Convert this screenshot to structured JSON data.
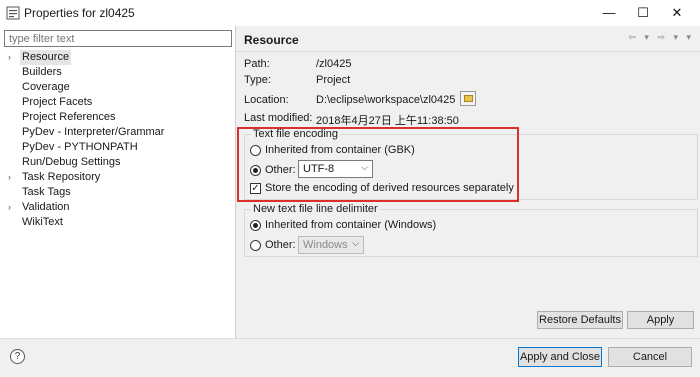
{
  "window": {
    "title": "Properties for zl0425",
    "minimize_glyph": "—",
    "maximize_glyph": "☐",
    "close_glyph": "✕"
  },
  "left": {
    "filter_placeholder": "type filter text",
    "tree": [
      {
        "label": "Resource",
        "expandable": true,
        "selected": true
      },
      {
        "label": "Builders",
        "expandable": false
      },
      {
        "label": "Coverage",
        "expandable": false
      },
      {
        "label": "Project Facets",
        "expandable": false
      },
      {
        "label": "Project References",
        "expandable": false
      },
      {
        "label": "PyDev - Interpreter/Grammar",
        "expandable": false
      },
      {
        "label": "PyDev - PYTHONPATH",
        "expandable": false
      },
      {
        "label": "Run/Debug Settings",
        "expandable": false
      },
      {
        "label": "Task Repository",
        "expandable": true
      },
      {
        "label": "Task Tags",
        "expandable": false
      },
      {
        "label": "Validation",
        "expandable": true
      },
      {
        "label": "WikiText",
        "expandable": false
      }
    ]
  },
  "right": {
    "title": "Resource",
    "nav_glyphs": "⇦ ▾ ⇨ ▾ ▾",
    "props": {
      "path_label": "Path:",
      "path_value": "/zl0425",
      "type_label": "Type:",
      "type_value": "Project",
      "location_label": "Location:",
      "location_value": "D:\\eclipse\\workspace\\zl0425",
      "modified_label": "Last modified:",
      "modified_value": "2018年4月27日 上午11:38:50"
    },
    "encoding": {
      "title": "Text file encoding",
      "inherited_label": "Inherited from container (GBK)",
      "other_label": "Other:",
      "other_value": "UTF-8",
      "store_label": "Store the encoding of derived resources separately",
      "selected": "other",
      "store_checked": true
    },
    "delimiter": {
      "title": "New text file line delimiter",
      "inherited_label": "Inherited from container (Windows)",
      "other_label": "Other:",
      "other_value": "Windows",
      "selected": "inherited"
    },
    "buttons": {
      "restore": "Restore Defaults",
      "apply": "Apply"
    }
  },
  "bottom": {
    "help_glyph": "?",
    "apply_close": "Apply and Close",
    "cancel": "Cancel"
  },
  "colors": {
    "highlight": "#d9302d",
    "default_button_border": "#0078d7",
    "panel_bg": "#f0f0f0"
  }
}
